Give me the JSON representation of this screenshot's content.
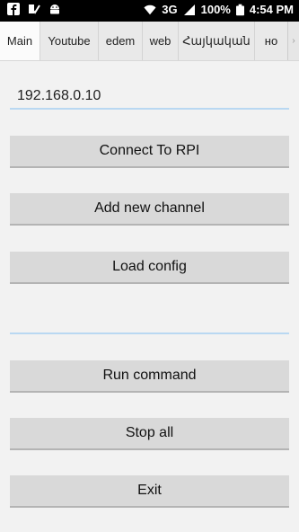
{
  "statusbar": {
    "network": "3G",
    "battery": "100%",
    "time": "4:54 PM",
    "icons": [
      "facebook-icon",
      "check-icon",
      "android-icon",
      "wifi-icon",
      "signal-icon",
      "battery-icon"
    ]
  },
  "tabs": [
    {
      "label": "Main",
      "active": true
    },
    {
      "label": "Youtube"
    },
    {
      "label": "edem"
    },
    {
      "label": "web"
    },
    {
      "label": "Հայկական"
    },
    {
      "label": "но"
    }
  ],
  "main": {
    "ip_value": "192.168.0.10",
    "connect_label": "Connect To RPI",
    "add_channel_label": "Add new channel",
    "load_config_label": "Load config",
    "command_value": "",
    "run_command_label": "Run command",
    "stop_all_label": "Stop all",
    "exit_label": "Exit"
  }
}
